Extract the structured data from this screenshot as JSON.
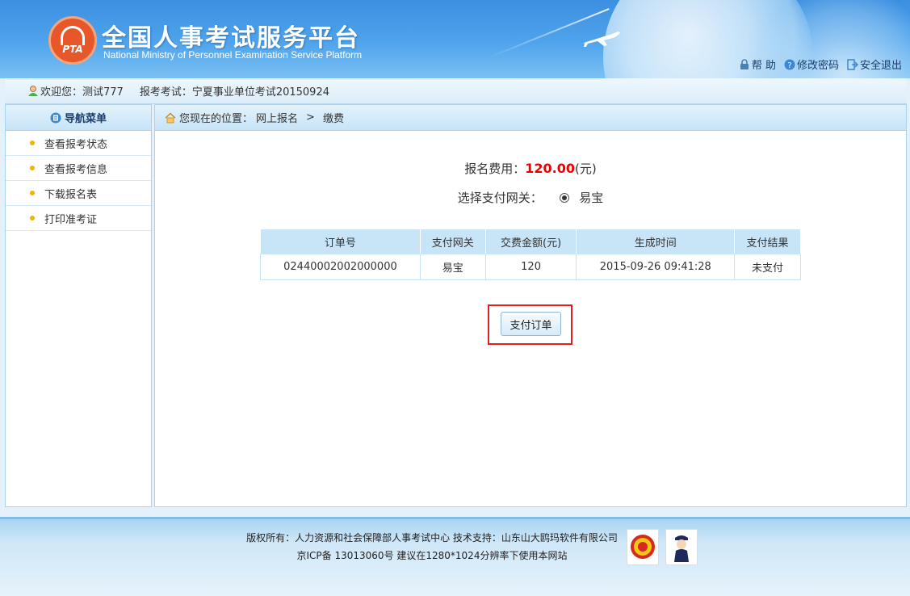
{
  "header": {
    "logo_text": "PTA",
    "title": "全国人事考试服务平台",
    "subtitle": "National Ministry of Personnel Examination Service Platform",
    "links": [
      {
        "label": "帮 助",
        "icon": "lock-icon"
      },
      {
        "label": "修改密码",
        "icon": "help-icon"
      },
      {
        "label": "安全退出",
        "icon": "logout-icon"
      }
    ]
  },
  "welcome": {
    "greeting": "欢迎您：测试777",
    "exam": "报考考试：宁夏事业单位考试20150924"
  },
  "sidebar": {
    "title": "导航菜单",
    "items": [
      {
        "label": "查看报考状态"
      },
      {
        "label": "查看报考信息"
      },
      {
        "label": "下载报名表"
      },
      {
        "label": "打印准考证"
      }
    ]
  },
  "breadcrumb": {
    "prefix": "您现在的位置：",
    "path1": "网上报名",
    "sep": ">",
    "path2": "缴费"
  },
  "payment": {
    "fee_label": "报名费用：",
    "fee_amount": "120.00",
    "fee_unit": "(元)",
    "gateway_label": "选择支付网关：",
    "gateway_option": "易宝",
    "button_label": "支付订单"
  },
  "orders": {
    "headers": [
      "订单号",
      "支付网关",
      "交费金额(元)",
      "生成时间",
      "支付结果"
    ],
    "rows": [
      [
        "02440002002000000",
        "易宝",
        "120",
        "2015-09-26 09:41:28",
        "未支付"
      ]
    ]
  },
  "footer": {
    "line1": "版权所有：人力资源和社会保障部人事考试中心  技术支持：山东山大鸥玛软件有限公司",
    "line2": "京ICP备 13013060号  建议在1280*1024分辨率下使用本网站"
  },
  "colors": {
    "header_blue": "#3c8fe0",
    "fee_red": "#e00000",
    "highlight_red": "#e02020",
    "table_header": "#c8e4f7"
  }
}
